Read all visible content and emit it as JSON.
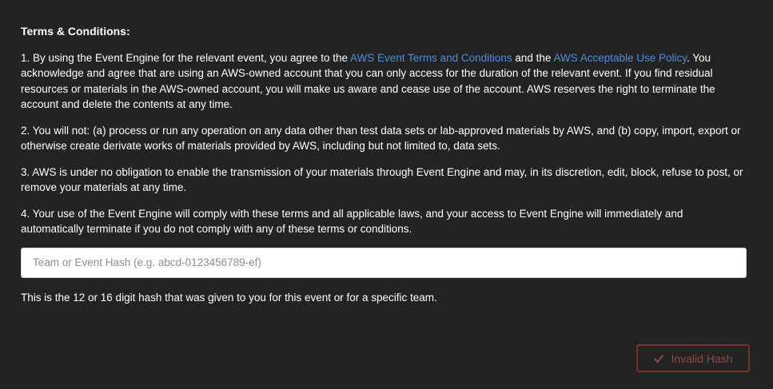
{
  "terms": {
    "title": "Terms & Conditions:",
    "p1": {
      "text_1": "1. By using the Event Engine for the relevant event, you agree to the ",
      "link_1": "AWS Event Terms and Conditions",
      "text_2": " and the ",
      "link_2": "AWS Acceptable Use Policy",
      "text_3": ". You acknowledge and agree that are using an AWS-owned account that you can only access for the duration of the relevant event. If you find residual resources or materials in the AWS-owned account, you will make us aware and cease use of the account. AWS reserves the right to terminate the account and delete the contents at any time."
    },
    "p2": "2. You will not: (a) process or run any operation on any data other than test data sets or lab-approved materials by AWS, and (b) copy, import, export or otherwise create derivate works of materials provided by AWS, including but not limited to, data sets.",
    "p3": "3. AWS is under no obligation to enable the transmission of your materials through Event Engine and may, in its discretion, edit, block, refuse to post, or remove your materials at any time.",
    "p4": "4. Your use of the Event Engine will comply with these terms and all applicable laws, and your access to Event Engine will immediately and automatically terminate if you do not comply with any of these terms or conditions."
  },
  "hash_input": {
    "placeholder": "Team or Event Hash (e.g. abcd-0123456789-ef)",
    "value": "",
    "hint": "This is the 12 or 16 digit hash that was given to you for this event or for a specific team."
  },
  "submit_button": {
    "label": "Invalid Hash",
    "icon": "check-icon",
    "color": "#7a2f30"
  },
  "colors": {
    "background": "#232323",
    "text": "#ffffff",
    "link": "#4a90d9"
  }
}
